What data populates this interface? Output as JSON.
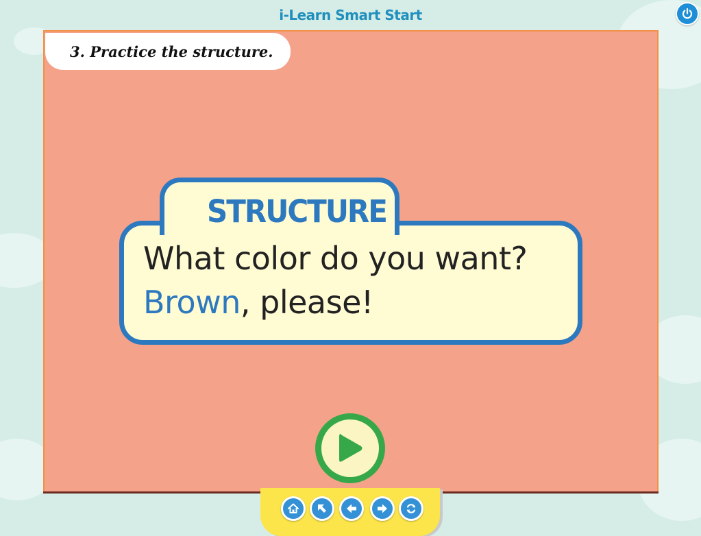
{
  "app": {
    "title": "i-Learn Smart Start"
  },
  "instruction": {
    "text": "3. Practice the structure."
  },
  "card": {
    "tab_label": "STRUCTURE",
    "question": "What color do you want?",
    "answer_highlight": "Brown",
    "answer_rest": ", please!"
  },
  "icons": {
    "power": "power-icon",
    "play": "play-icon",
    "nav": [
      "home-icon",
      "arrow-up-left-icon",
      "arrow-left-icon",
      "arrow-right-icon",
      "refresh-icon"
    ]
  },
  "colors": {
    "background": "#d6ede7",
    "stage": "#f5a28a",
    "card_fill": "#fffbd3",
    "card_border": "#2d79bf",
    "play_green": "#37a84a",
    "nav_tray": "#fbe54a",
    "nav_button": "#3591d6",
    "title": "#1f8fbd"
  }
}
